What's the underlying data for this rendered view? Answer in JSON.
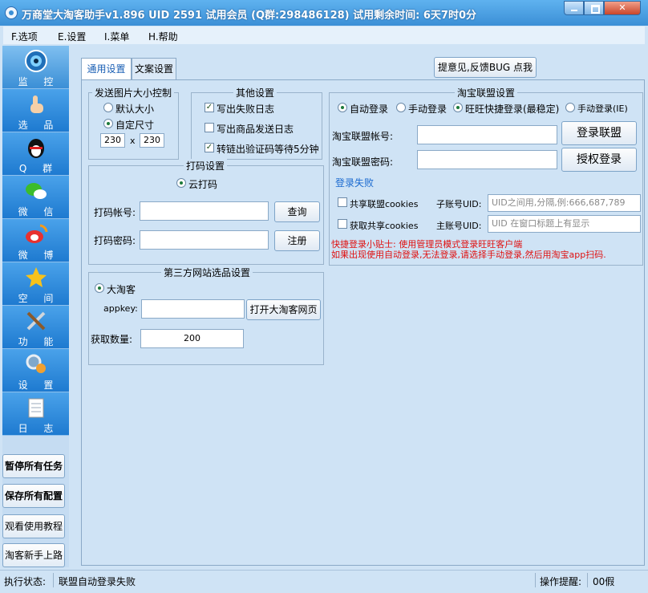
{
  "window": {
    "title": "万商堂大淘客助手v1.896  UID 2591  试用会员  (Q群:298486128) 试用剩余时间: 6天7时0分"
  },
  "menu": [
    "F.选项",
    "E.设置",
    "I.菜单",
    "H.帮助"
  ],
  "sidebar": {
    "nav": [
      "监 控",
      "选 品",
      "Q 群",
      "微 信",
      "微 博",
      "空 间",
      "功 能",
      "设 置",
      "日 志"
    ],
    "buttons": [
      "暂停所有任务",
      "保存所有配置",
      "观看使用教程",
      "淘客新手上路"
    ]
  },
  "tabs": [
    "通用设置",
    "文案设置"
  ],
  "feedback_button": "提意见,反馈BUG 点我",
  "image_size": {
    "title": "发送图片大小控制",
    "option_default": "默认大小",
    "option_custom": "自定尺寸",
    "width": "230",
    "x": "x",
    "height": "230"
  },
  "other": {
    "title": "其他设置",
    "c1": "写出失败日志",
    "c2": "写出商品发送日志",
    "c3": "转链出验证码等待5分钟"
  },
  "captcha": {
    "title": "打码设置",
    "option": "云打码",
    "account_label": "打码帐号:",
    "password_label": "打码密码:",
    "query_button": "查询",
    "register_button": "注册"
  },
  "third": {
    "title": "第三方网站选品设置",
    "option": "大淘客",
    "appkey_label": "appkey:",
    "open_button": "打开大淘客网页",
    "count_label": "获取数量:",
    "count_value": "200"
  },
  "alliance": {
    "title": "淘宝联盟设置",
    "modes": [
      "自动登录",
      "手动登录",
      "旺旺快捷登录(最稳定)",
      "手动登录(IE)"
    ],
    "account_label": "淘宝联盟帐号:",
    "password_label": "淘宝联盟密码:",
    "login_button": "登录联盟",
    "auth_button": "授权登录",
    "status": "登录失败",
    "share_cookies": "共享联盟cookies",
    "sub_uid_label": "子账号UID:",
    "sub_uid_placeholder": "UID之间用,分隔,例:666,687,789",
    "get_cookies": "获取共享cookies",
    "main_uid_label": "主账号UID:",
    "main_uid_placeholder": "UID 在窗口标题上有显示",
    "tip1": "快捷登录小贴士: 使用管理员模式登录旺旺客户端",
    "tip2": "如果出现使用自动登录,无法登录,请选择手动登录,然后用淘宝app扫码."
  },
  "status": {
    "label": "执行状态:",
    "text": "联盟自动登录失败",
    "hint_label": "操作提醒:",
    "hint_value": "00假"
  },
  "colors": {
    "title_bar": "#3b8fd6",
    "nav_active": "#3b8fd6",
    "warning": "#e01010",
    "link": "#1a6ad0"
  }
}
